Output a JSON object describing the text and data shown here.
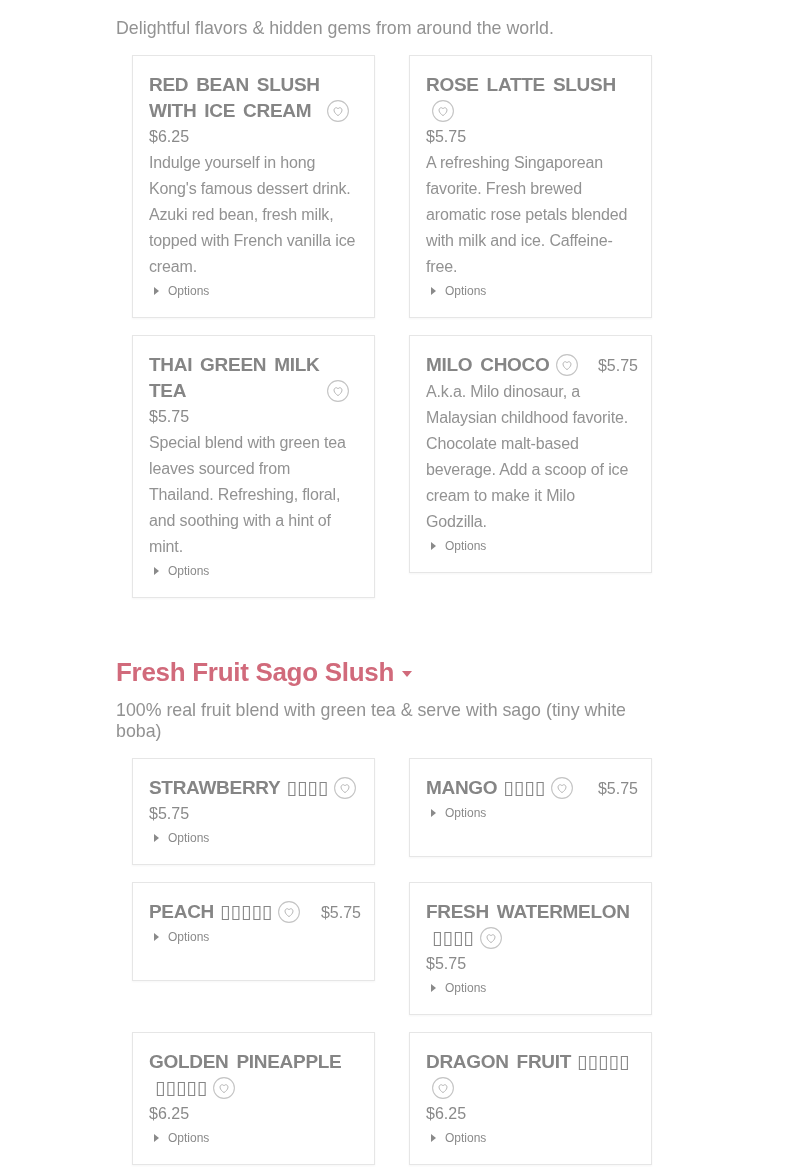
{
  "sections": [
    {
      "description": "Delightful flavors & hidden gems from around the world.",
      "items": [
        {
          "name": "RED BEAN SLUSH WITH ICE CREAM",
          "price": "$6.25",
          "description": "Indulge yourself in hong Kong's famous dessert drink. Azuki red bean, fresh milk, topped with French vanilla ice cream.",
          "options": {
            "label": "Options",
            "expanded": false
          }
        },
        {
          "name": "ROSE LATTE SLUSH",
          "price": "$5.75",
          "description": "A refreshing Singaporean favorite. Fresh brewed aromatic rose petals blended with milk and ice. Caffeine-free.",
          "options": {
            "label": "Options",
            "expanded": false
          }
        },
        {
          "name": "THAI GREEN MILK TEA",
          "price": "$5.75",
          "description": "Special blend with green tea leaves sourced from Thailand. Refreshing, floral, and soothing with a hint of mint.",
          "options": {
            "label": "Options",
            "expanded": false
          }
        },
        {
          "name": "MILO CHOCO",
          "price": "$5.75",
          "description": "A.k.a. Milo dinosaur, a Malaysian childhood favorite. Chocolate malt-based beverage. Add a scoop of ice cream to make it Milo Godzilla.",
          "options": {
            "label": "Options",
            "expanded": false
          }
        }
      ]
    },
    {
      "title": "Fresh Fruit Sago Slush",
      "description": "100% real fruit blend with green tea & serve with sago (tiny white boba)",
      "items": [
        {
          "name": "STRAWBERRY",
          "glyphs": "▯▯▯▯",
          "price": "$5.75",
          "options": {
            "label": "Options",
            "expanded": false
          }
        },
        {
          "name": "MANGO",
          "glyphs": "▯▯▯▯",
          "price": "$5.75",
          "options": {
            "label": "Options",
            "expanded": false
          }
        },
        {
          "name": "PEACH",
          "glyphs": "▯▯▯▯▯",
          "price": "$5.75",
          "options": {
            "label": "Options",
            "expanded": false
          }
        },
        {
          "name": "FRESH WATERMELON",
          "glyphs": "▯▯▯▯",
          "price": "$5.75",
          "options": {
            "label": "Options",
            "expanded": false
          }
        },
        {
          "name": "GOLDEN PINEAPPLE",
          "glyphs": "▯▯▯▯▯",
          "price": "$6.25",
          "options": {
            "label": "Options",
            "expanded": false
          }
        },
        {
          "name": "DRAGON FRUIT",
          "glyphs": "▯▯▯▯▯",
          "price": "$6.25",
          "options": {
            "label": "Options",
            "expanded": false
          }
        }
      ]
    }
  ]
}
